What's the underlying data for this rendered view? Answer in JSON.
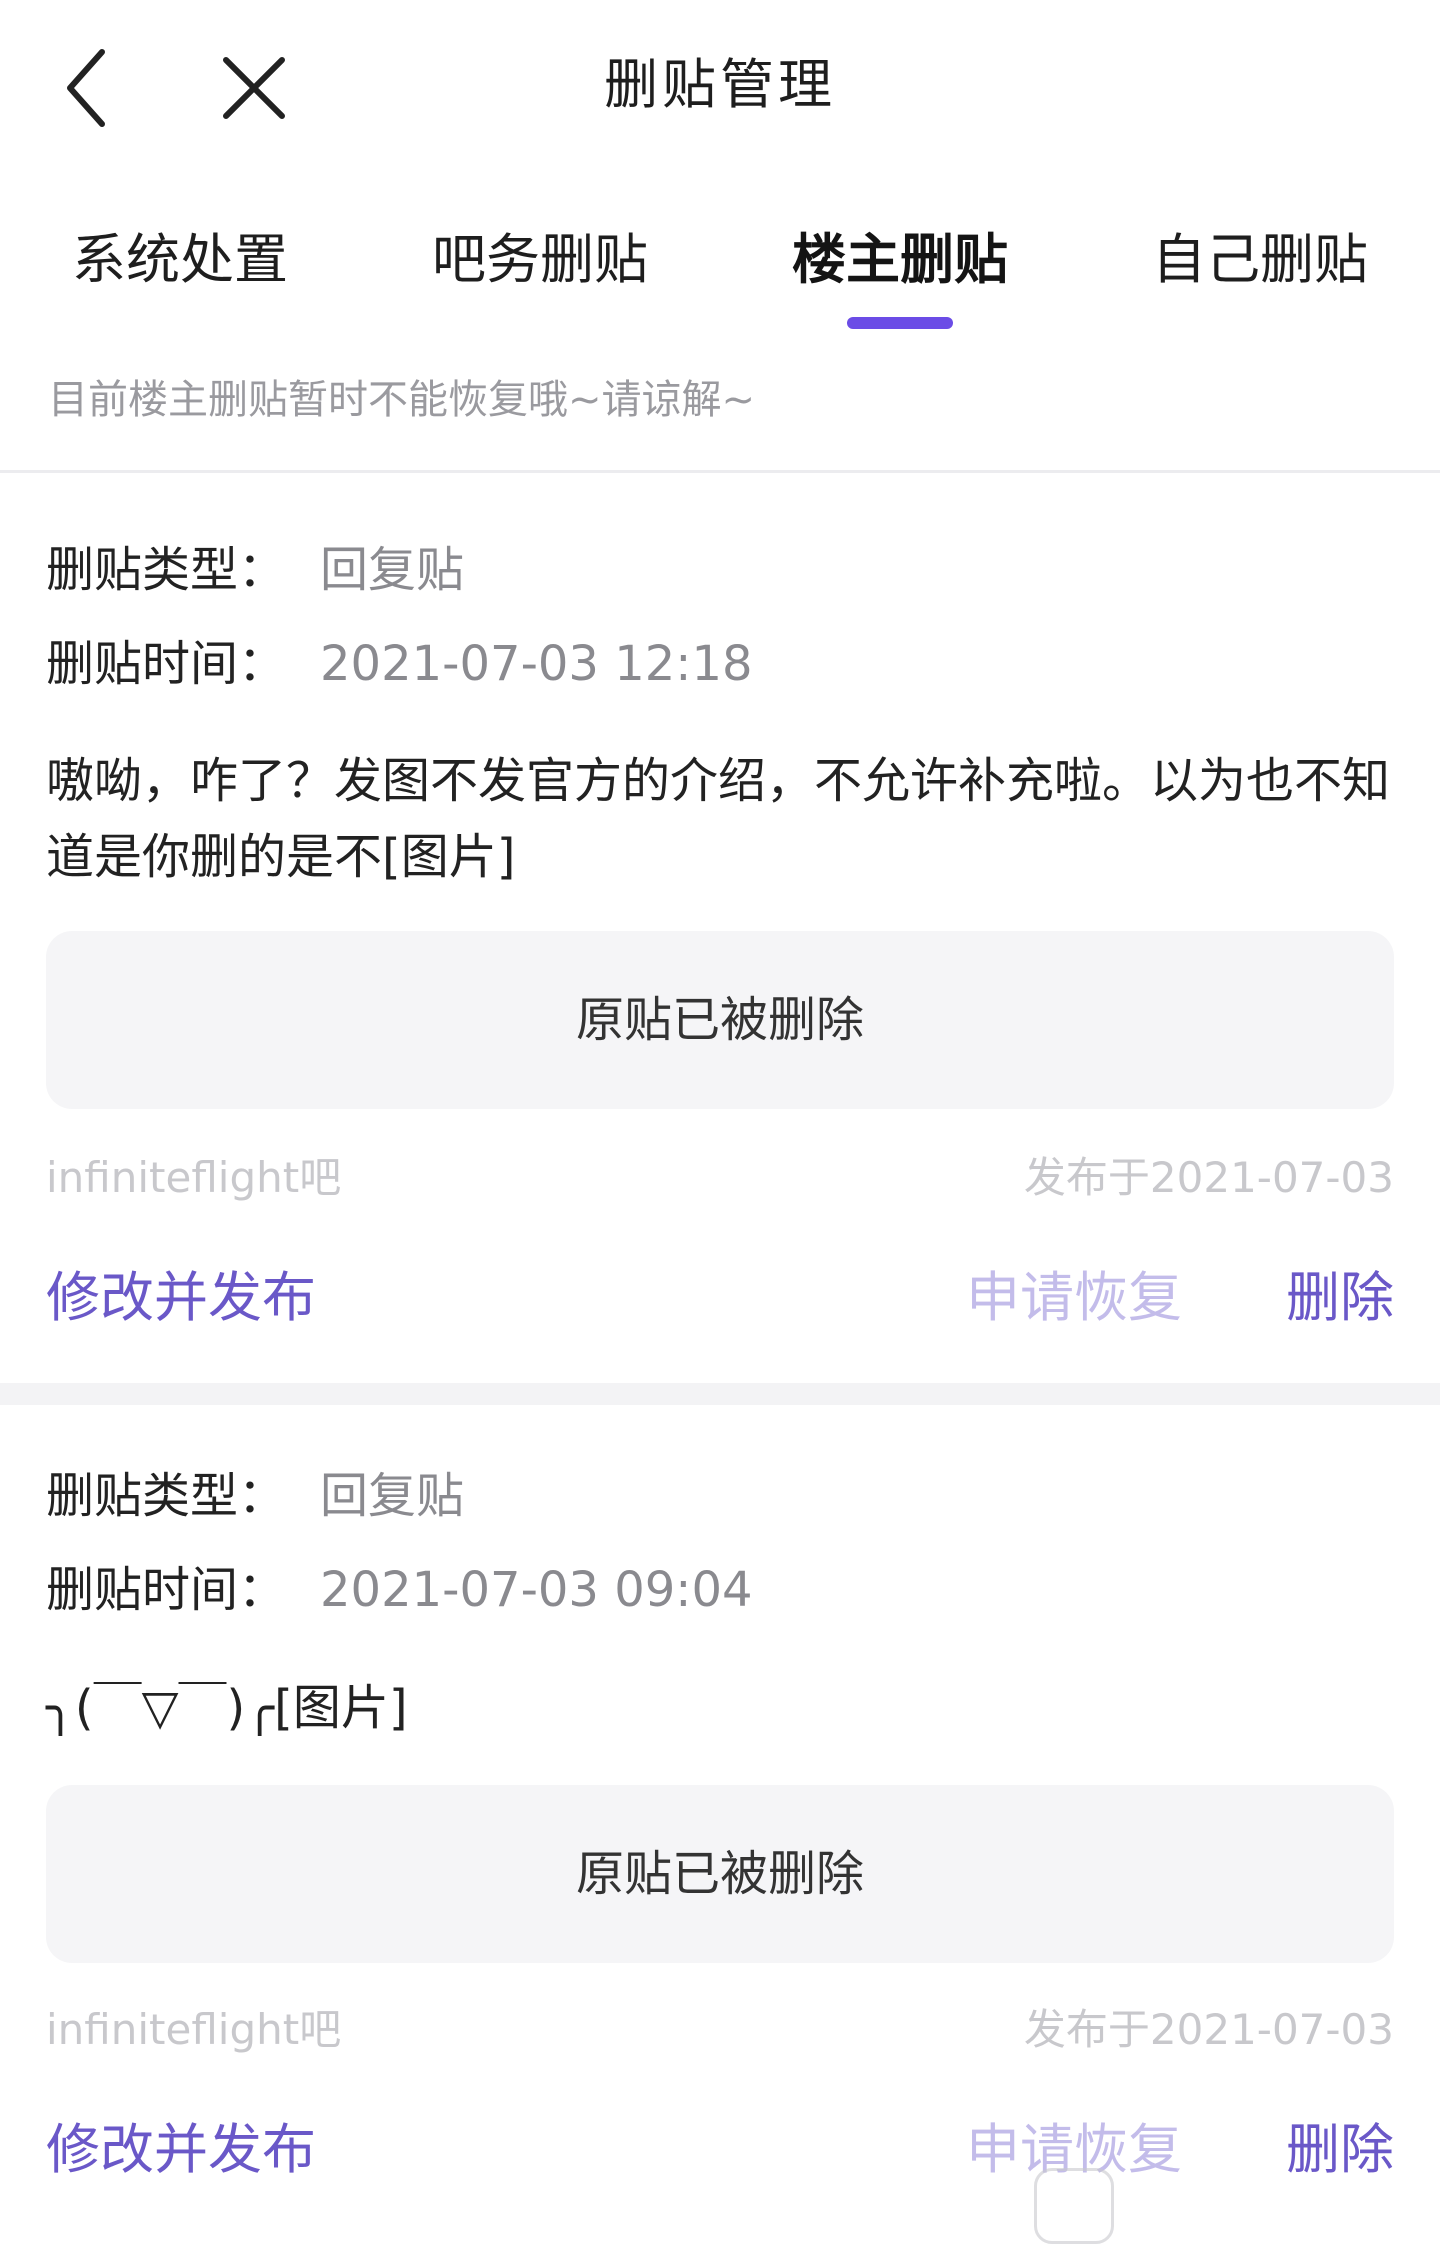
{
  "header": {
    "title": "删贴管理",
    "back_icon": "chevron-left-icon",
    "close_icon": "close-icon"
  },
  "tabs": [
    {
      "label": "系统处置",
      "active": false
    },
    {
      "label": "吧务删贴",
      "active": false
    },
    {
      "label": "楼主删贴",
      "active": true
    },
    {
      "label": "自己删贴",
      "active": false
    }
  ],
  "accent_color": "#6b4ce6",
  "notice": "目前楼主删贴暂时不能恢复哦~请谅解~",
  "labels": {
    "type_label": "删贴类型：",
    "time_label": "删贴时间："
  },
  "posts": [
    {
      "type": "回复贴",
      "time": "2021-07-03 12:18",
      "content": "嗷呦，咋了？发图不发官方的介绍，不允许补充啦。以为也不知道是你删的是不[图片]",
      "original_status": "原贴已被删除",
      "forum": "infiniteflight吧",
      "published": "发布于2021-07-03",
      "actions": {
        "edit": "修改并发布",
        "restore": "申请恢复",
        "delete": "删除"
      }
    },
    {
      "type": "回复贴",
      "time": "2021-07-03 09:04",
      "content": "╮(￣▽￣)╭[图片]",
      "original_status": "原贴已被删除",
      "forum": "infiniteflight吧",
      "published": "发布于2021-07-03",
      "actions": {
        "edit": "修改并发布",
        "restore": "申请恢复",
        "delete": "删除"
      }
    }
  ]
}
